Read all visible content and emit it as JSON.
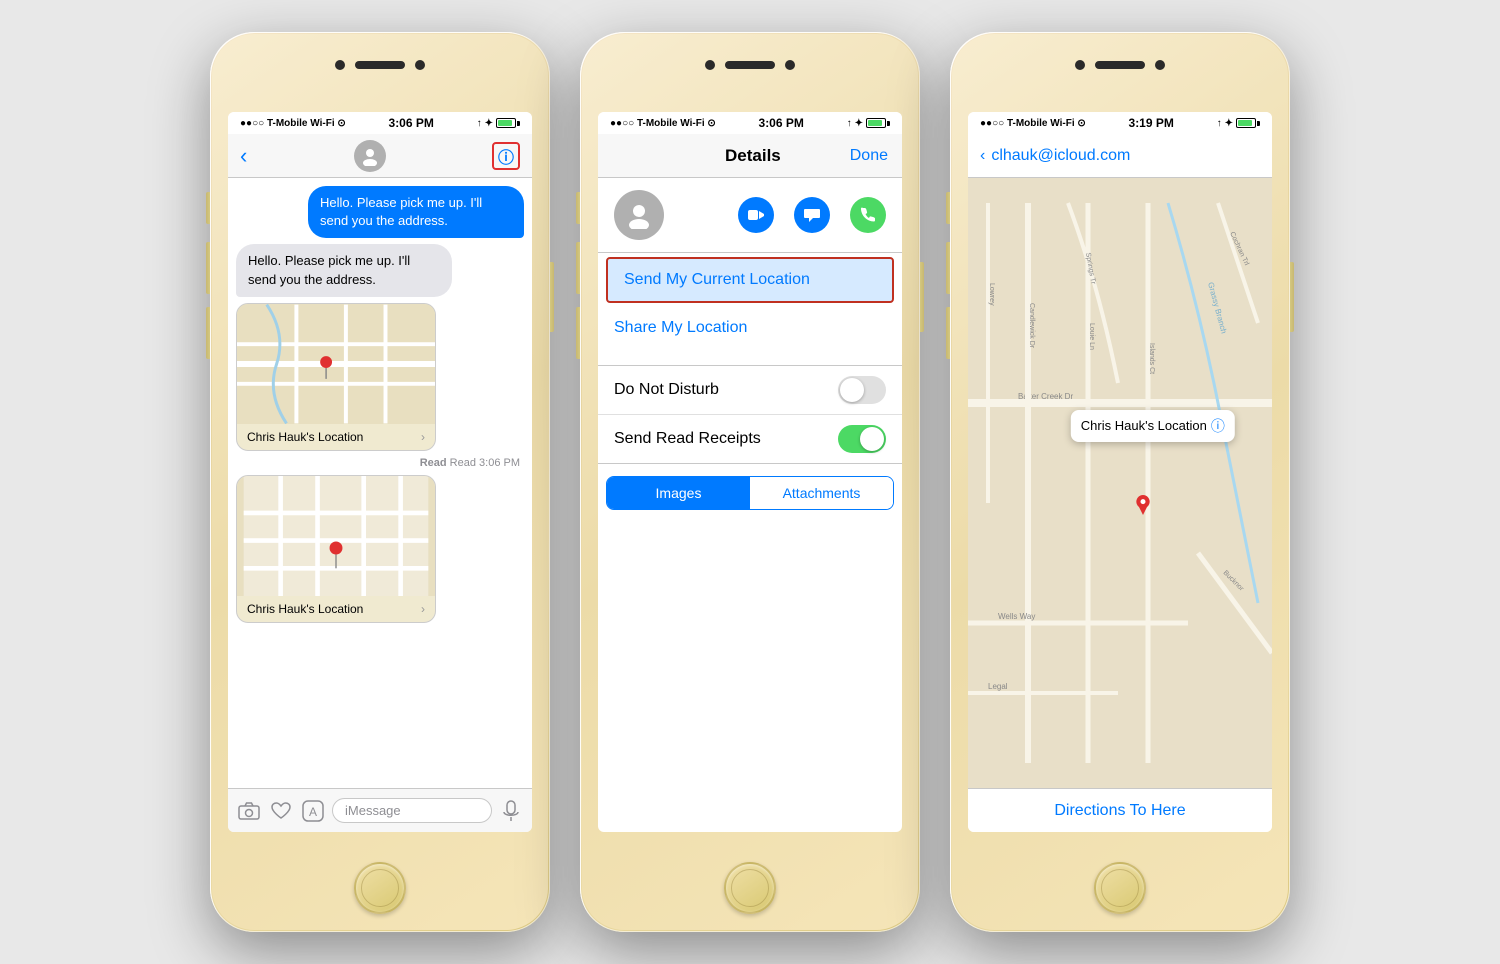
{
  "phone1": {
    "status": {
      "carrier": "●●○○ T-Mobile Wi-Fi ⊙",
      "time": "3:06 PM",
      "icons": "↑ ✦ 92%"
    },
    "nav": {
      "back_label": "‹",
      "info_label": "ⓘ"
    },
    "messages": [
      {
        "type": "out",
        "text": "Hello. Please pick me up. I'll send you the address."
      },
      {
        "type": "in",
        "text": "Hello. Please pick me up. I'll send you the address."
      }
    ],
    "map_card1": {
      "label": "Chris Hauk's Location"
    },
    "read_stamp": "Read 3:06 PM",
    "map_card2": {
      "label": "Chris Hauk's Location"
    },
    "input_placeholder": "iMessage"
  },
  "phone2": {
    "status": {
      "carrier": "●●○○ T-Mobile Wi-Fi ⊙",
      "time": "3:06 PM",
      "icons": "↑ ✦ 92%"
    },
    "nav": {
      "title": "Details",
      "done_label": "Done"
    },
    "location": {
      "send_current": "Send My Current Location",
      "share": "Share My Location"
    },
    "settings": {
      "do_not_disturb": "Do Not Disturb",
      "send_read_receipts": "Send Read Receipts"
    },
    "tabs": {
      "images": "Images",
      "attachments": "Attachments"
    }
  },
  "phone3": {
    "status": {
      "carrier": "●●○○ T-Mobile Wi-Fi ⊙",
      "time": "3:19 PM",
      "icons": "↑ ✦ 96%"
    },
    "nav": {
      "back_label": "‹",
      "contact": "clhauk@icloud.com"
    },
    "pin_label": "Chris Hauk's Location",
    "directions": "Directions To Here",
    "map_roads": [
      "Baker Creek Dr",
      "Grassy Branch",
      "Lowrey",
      "Candlewick Dr",
      "Wells Way",
      "Bucknor",
      "Legal",
      "Islands Ct",
      "Louie Ln"
    ]
  }
}
